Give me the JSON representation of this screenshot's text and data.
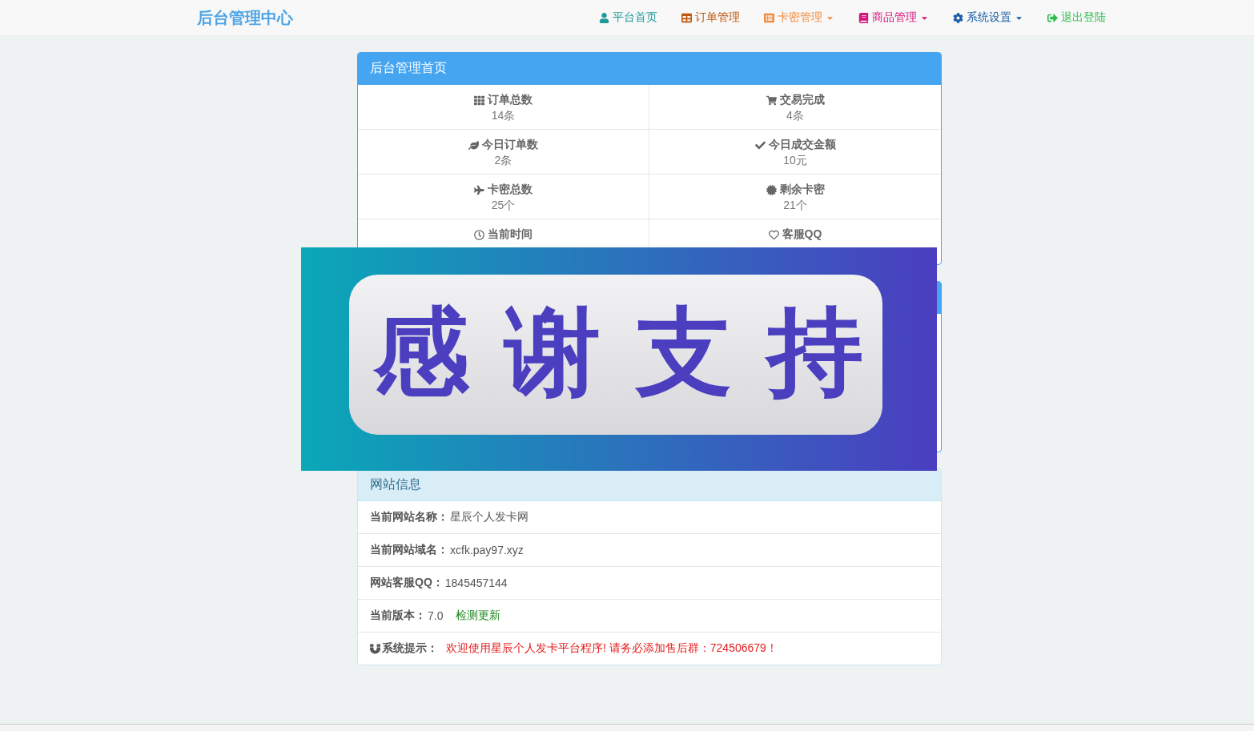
{
  "brand": "后台管理中心",
  "nav": [
    {
      "label": "平台首页",
      "color": "#1f9a9a",
      "dropdown": false
    },
    {
      "label": "订单管理",
      "color": "#c0570c",
      "dropdown": false
    },
    {
      "label": "卡密管理",
      "color": "#f08a3c",
      "dropdown": true
    },
    {
      "label": "商品管理",
      "color": "#d4157c",
      "dropdown": true
    },
    {
      "label": "系统设置",
      "color": "#1b5ea6",
      "dropdown": true
    },
    {
      "label": "退出登陆",
      "color": "#2dbf4b",
      "dropdown": false
    }
  ],
  "dashboard": {
    "title": "后台管理首页",
    "stats": [
      {
        "label": "订单总数",
        "value": "14条"
      },
      {
        "label": "交易完成",
        "value": "4条"
      },
      {
        "label": "今日订单数",
        "value": "2条"
      },
      {
        "label": "今日成交金额",
        "value": "10元"
      },
      {
        "label": "卡密总数",
        "value": "25个"
      },
      {
        "label": "剩余卡密",
        "value": "21个"
      },
      {
        "label": "当前时间"
      },
      {
        "label": "客服QQ"
      }
    ]
  },
  "banner": {
    "text": "感谢支持"
  },
  "info": {
    "title": "网站信息",
    "rows": [
      {
        "kind": "plain",
        "label": "当前网站名称：",
        "value": "星辰个人发卡网"
      },
      {
        "kind": "plain",
        "label": "当前网站域名：",
        "value": "xcfk.pay97.xyz"
      },
      {
        "kind": "plain",
        "label": "网站客服QQ：",
        "value": "1845457144"
      },
      {
        "kind": "version",
        "label": "当前版本：",
        "value": "7.0",
        "link": "检测更新"
      },
      {
        "kind": "notice",
        "label": "系统提示：",
        "value": "欢迎使用星辰个人发卡平台程序! 请务必添加售后群：724506679！"
      }
    ]
  }
}
